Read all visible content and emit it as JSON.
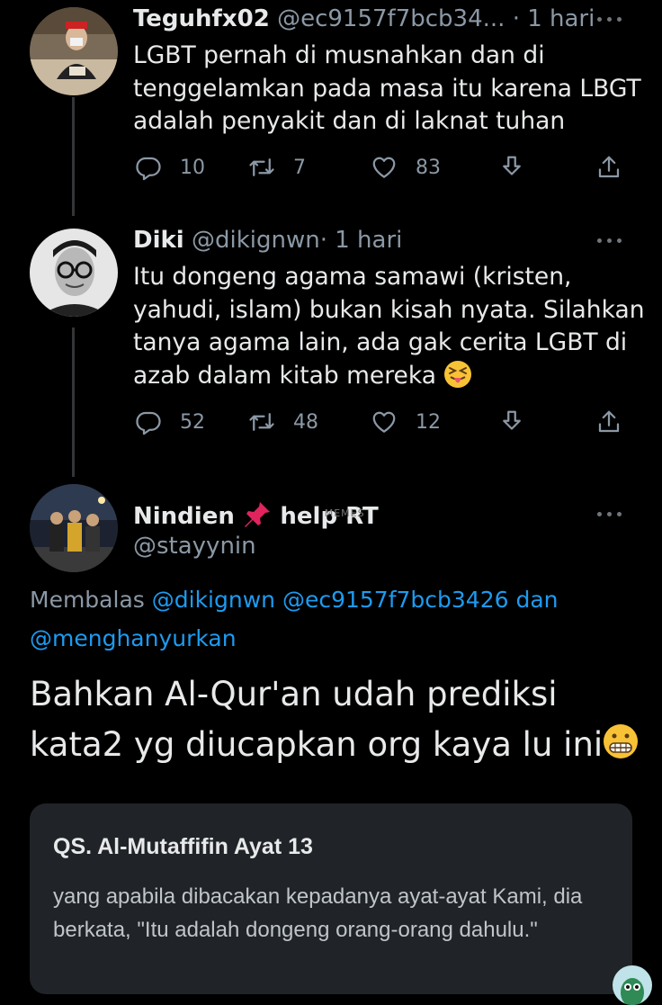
{
  "colors": {
    "background": "#000000",
    "text": "#e7e9ea",
    "secondary": "#8b98a5",
    "link": "#1d9bf0",
    "card": "#202327"
  },
  "tweets": [
    {
      "name": "Teguhfx02",
      "handle": "@ec9157f7bcb34...",
      "separator": "·",
      "time": "1 hari",
      "text": "LGBT pernah di musnahkan dan di tenggelamkan pada masa itu karena LBGT adalah penyakit dan di laknat  tuhan",
      "reply_count": "10",
      "retweet_count": "7",
      "like_count": "83"
    },
    {
      "name": "Diki",
      "handle": "@dikignwn",
      "separator": "·",
      "time": "1 hari",
      "text": "Itu dongeng agama samawi (kristen, yahudi, islam) bukan kisah nyata. Silahkan tanya agama lain, ada gak cerita LGBT di azab dalam kitab mereka",
      "emoji": "squinting-tongue-face",
      "reply_count": "52",
      "retweet_count": "48",
      "like_count": "12"
    }
  ],
  "main_tweet": {
    "name": "Nindien",
    "name_emoji": "pushpin",
    "name_suffix": "help RT",
    "watermark": "MEMES",
    "handle": "@stayynin",
    "reply_prefix": "Membalas",
    "reply_mention_1": "@dikignwn",
    "reply_mention_2": "@ec9157f7bcb3426",
    "reply_and": "dan",
    "reply_mention_3": "@menghanyurkan",
    "text": "Bahkan Al-Qur'an udah prediksi kata2 yg diucapkan org kaya lu ini",
    "text_emoji": "grimacing-face",
    "quote": {
      "title": "QS. Al-Mutaffifin Ayat 13",
      "body": "yang apabila dibacakan kepadanya ayat-ayat Kami, dia berkata, \"Itu adalah dongeng orang-orang dahulu.\""
    }
  }
}
